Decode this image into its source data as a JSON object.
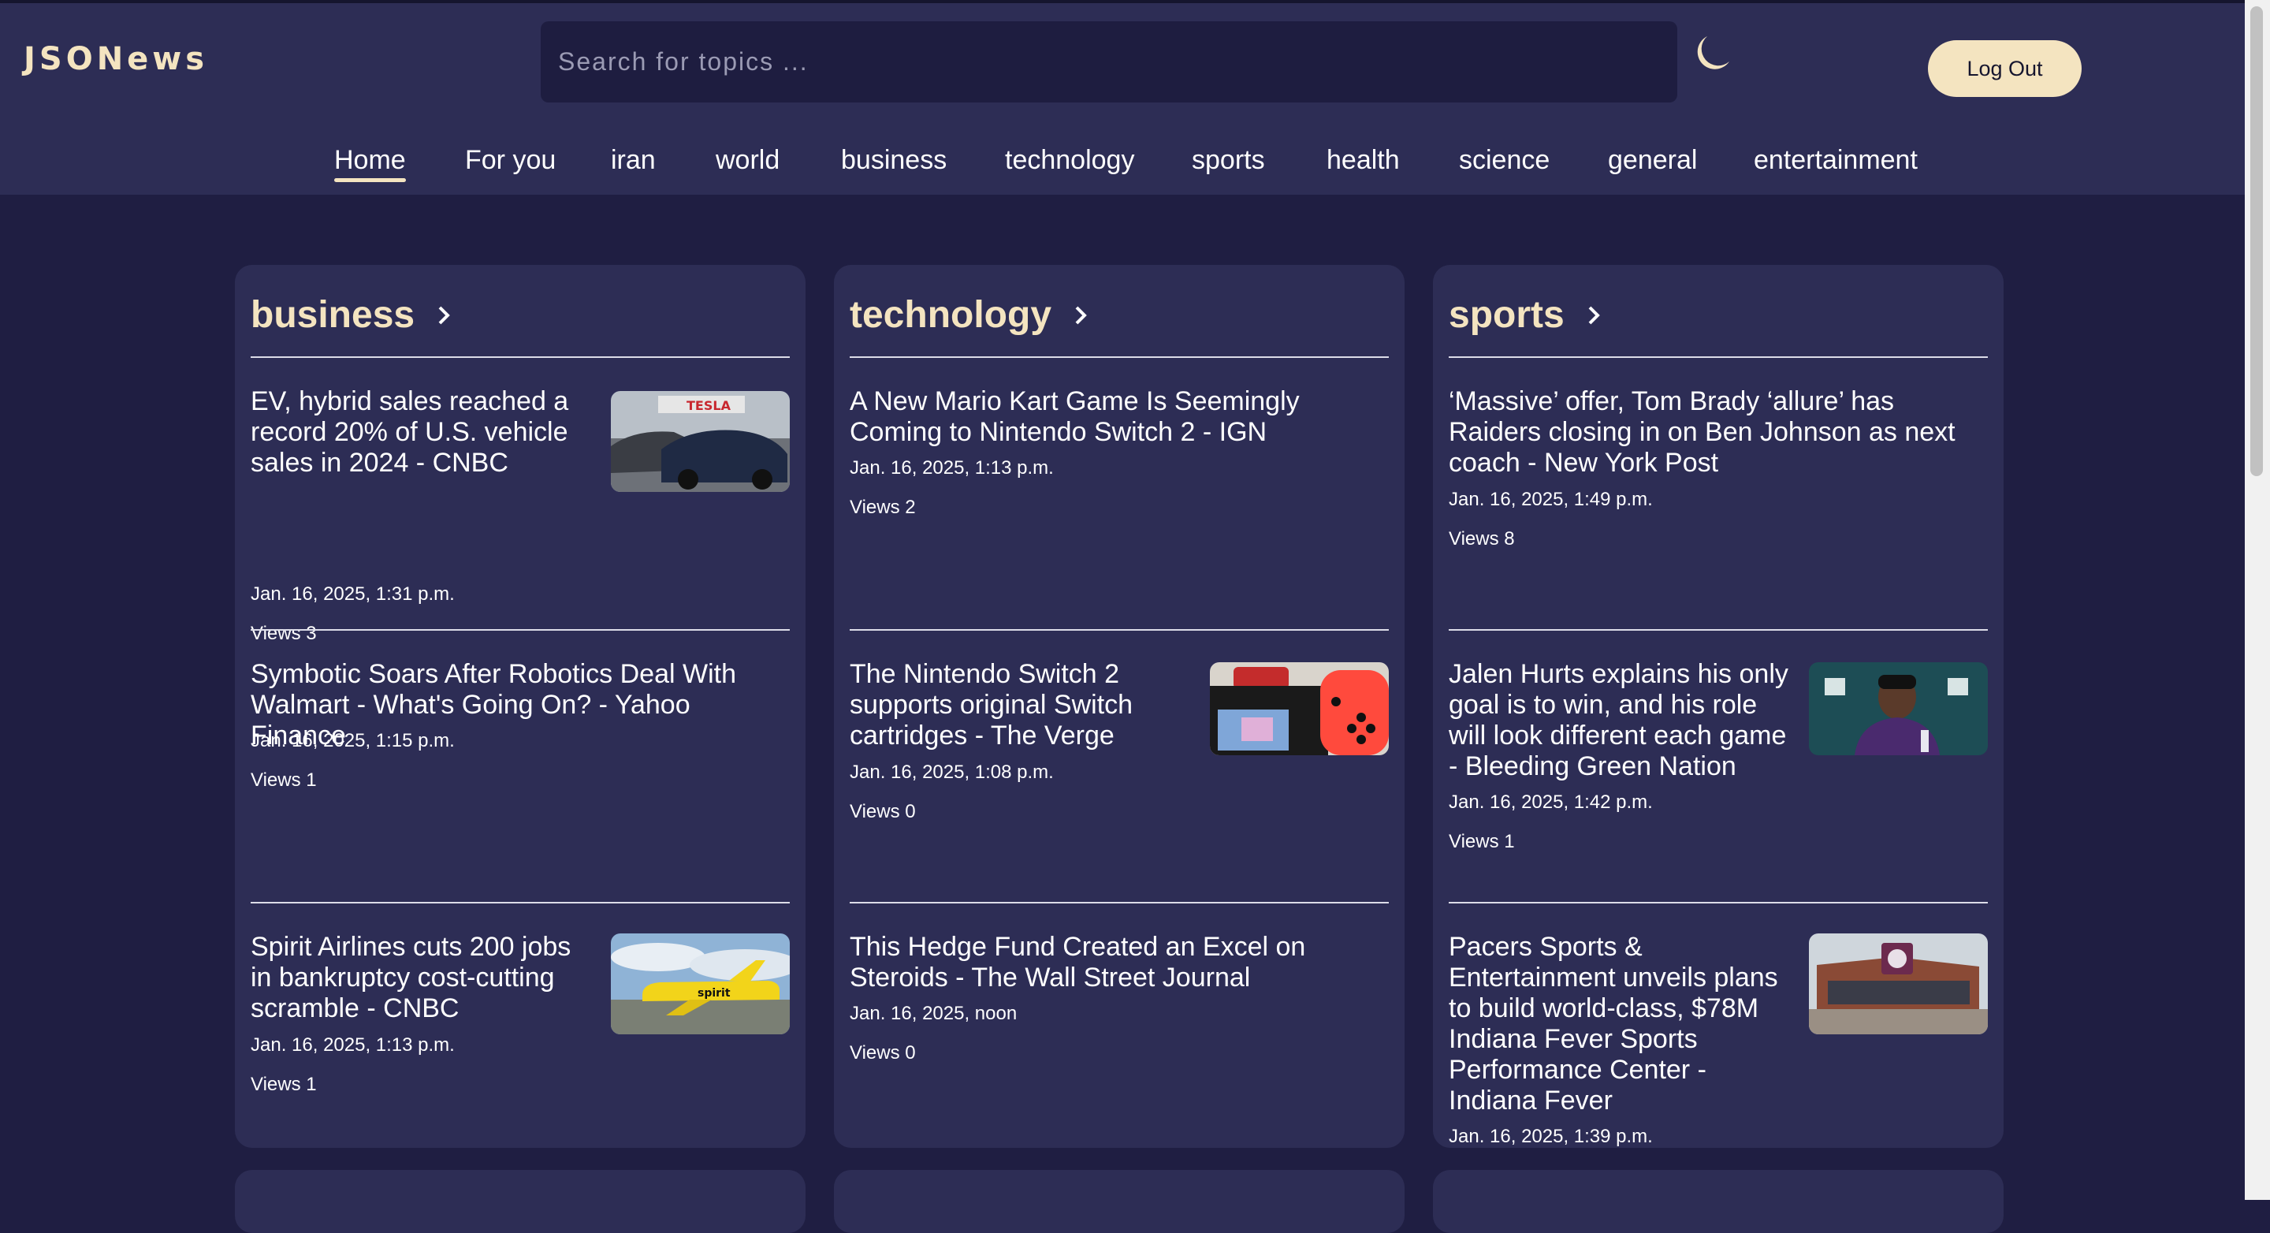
{
  "header": {
    "logo": "JSONews",
    "search_placeholder": "Search for topics ...",
    "theme_icon": "moon-icon",
    "logout_label": "Log Out"
  },
  "nav": {
    "items": [
      "Home",
      "For you",
      "iran",
      "world",
      "business",
      "technology",
      "sports",
      "health",
      "science",
      "general",
      "entertainment"
    ],
    "active": "Home"
  },
  "colors": {
    "background": "#1f1e42",
    "panel": "#2d2d55",
    "accent": "#f4e4c0",
    "text": "#ffffff"
  },
  "sections": [
    {
      "title": "business",
      "articles": [
        {
          "title": "EV, hybrid sales reached a record 20% of U.S. vehicle sales in 2024 - CNBC",
          "date": "Jan. 16, 2025, 1:31 p.m.",
          "views": "Views 3",
          "image": "tesla-cars-photo"
        },
        {
          "title": "Symbotic Soars After Robotics Deal With Walmart - What's Going On? - Yahoo Finance",
          "date": "Jan. 16, 2025, 1:15 p.m.",
          "views": "Views 1",
          "image": ""
        },
        {
          "title": "Spirit Airlines cuts 200 jobs in bankruptcy cost-cutting scramble - CNBC",
          "date": "Jan. 16, 2025, 1:13 p.m.",
          "views": "Views 1",
          "image": "spirit-airplane-photo"
        }
      ]
    },
    {
      "title": "technology",
      "articles": [
        {
          "title": "A New Mario Kart Game Is Seemingly Coming to Nintendo Switch 2 - IGN",
          "date": "Jan. 16, 2025, 1:13 p.m.",
          "views": "Views 2",
          "image": ""
        },
        {
          "title": "The Nintendo Switch 2 supports original Switch cartridges - The Verge",
          "date": "Jan. 16, 2025, 1:08 p.m.",
          "views": "Views 0",
          "image": "nintendo-switch-photo"
        },
        {
          "title": "This Hedge Fund Created an Excel on Steroids - The Wall Street Journal",
          "date": "Jan. 16, 2025, noon",
          "views": "Views 0",
          "image": ""
        }
      ]
    },
    {
      "title": "sports",
      "articles": [
        {
          "title": "‘Massive’ offer, Tom Brady ‘allure’ has Raiders closing in on Ben Johnson as next coach - New York Post",
          "date": "Jan. 16, 2025, 1:49 p.m.",
          "views": "Views 8",
          "image": ""
        },
        {
          "title": "Jalen Hurts explains his only goal is to win, and his role will look different each game - Bleeding Green Nation",
          "date": "Jan. 16, 2025, 1:42 p.m.",
          "views": "Views 1",
          "image": "press-conference-photo"
        },
        {
          "title": "Pacers Sports & Entertainment unveils plans to build world-class, $78M Indiana Fever Sports Performance Center - Indiana Fever",
          "date": "Jan. 16, 2025, 1:39 p.m.",
          "views": "",
          "image": "arena-building-photo"
        }
      ]
    }
  ]
}
